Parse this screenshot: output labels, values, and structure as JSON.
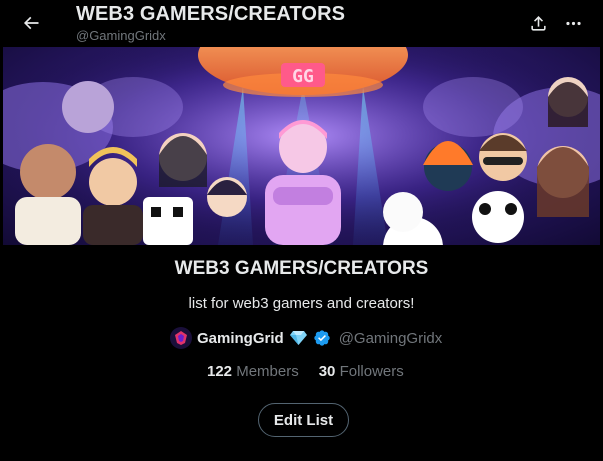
{
  "header": {
    "title": "WEB3 GAMERS/CREATORS",
    "handle": "@GamingGridx",
    "back_icon": "arrow-left-icon",
    "share_icon": "share-icon",
    "more_icon": "more-horizontal-icon"
  },
  "banner": {
    "logo_text": "GG",
    "description_icon": "cartoon-group-illustration"
  },
  "list": {
    "name": "WEB3 GAMERS/CREATORS",
    "description": "list for web3 gamers and creators!",
    "owner_name": "GamingGrid",
    "owner_handle": "@GamingGridx",
    "members_count": "122",
    "members_label": "Members",
    "followers_count": "30",
    "followers_label": "Followers",
    "edit_button": "Edit List"
  },
  "colors": {
    "background": "#000000",
    "text_primary": "#e7e9ea",
    "text_secondary": "#71767b",
    "verified_blue": "#1d9bf0",
    "diamond": "#7fd3f7"
  }
}
